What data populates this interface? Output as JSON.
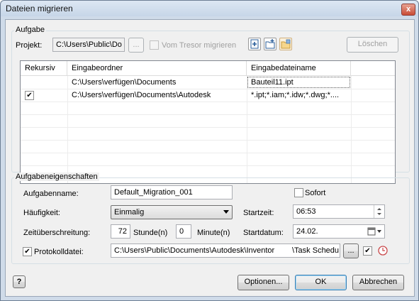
{
  "window": {
    "title": "Dateien migrieren",
    "close_glyph": "x"
  },
  "aufgabe": {
    "group_title": "Aufgabe",
    "projekt_label": "Projekt:",
    "projekt_value": "C:\\Users\\Public\\Do",
    "browse_label": "...",
    "tresor_label": "Vom Tresor migrieren",
    "loeschen_label": "Löschen",
    "table": {
      "headers": [
        "Rekursiv",
        "Eingabeordner",
        "Eingabedateiname"
      ],
      "rows": [
        {
          "rekursiv": "",
          "ordner": "C:\\Users\\verfügen\\Documents",
          "datei": "Bauteil11.ipt"
        },
        {
          "rekursiv": "✔",
          "ordner": "C:\\Users\\verfügen\\Documents\\Autodesk",
          "datei": "*.ipt;*.iam;*.idw;*.dwg;*...."
        }
      ]
    }
  },
  "eigenschaften": {
    "group_title": "Aufgabeneigenschaften",
    "name_label": "Aufgabenname:",
    "name_value": "Default_Migration_001",
    "sofort_label": "Sofort",
    "haeufigkeit_label": "Häufigkeit:",
    "haeufigkeit_value": "Einmalig",
    "startzeit_label": "Startzeit:",
    "startzeit_value": "06:53",
    "zeit_label": "Zeitüberschreitung:",
    "stunden_value": "72",
    "stunden_label": "Stunde(n)",
    "minuten_value": "0",
    "minuten_label": "Minute(n)",
    "startdatum_label": "Startdatum:",
    "startdatum_value": "24.02.",
    "protokoll_label": "Protokolldatei:",
    "protokoll_value": "C:\\Users\\Public\\Documents\\Autodesk\\Inventor",
    "protokoll_value2": "\\Task Schedu",
    "protokoll_browse": "..."
  },
  "footer": {
    "help_glyph": "?",
    "optionen_label": "Optionen...",
    "ok_label": "OK",
    "abbrechen_label": "Abbrechen"
  },
  "colors": {
    "accent": "#3c7fb1",
    "checkmark": "#000000"
  }
}
